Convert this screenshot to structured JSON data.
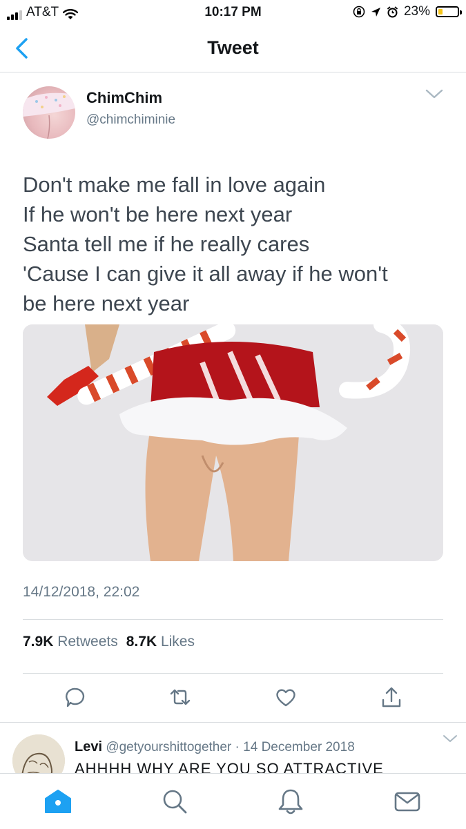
{
  "status_bar": {
    "carrier": "AT&T",
    "time": "10:17 PM",
    "battery": "23%",
    "battery_level": 0.23
  },
  "header": {
    "title": "Tweet",
    "back_icon": "chevron-left-icon"
  },
  "tweet": {
    "author_name": "ChimChim",
    "author_handle": "@chimchiminie",
    "lines": [
      "Don't make me fall in love again",
      "If he won't be here next year",
      "Santa tell me if he really cares",
      "'Cause I can give it all away if he won't",
      "be here next year"
    ],
    "timestamp": "14/12/2018, 22:02",
    "retweets_count": "7.9K",
    "retweets_label": "Retweets",
    "likes_count": "8.7K",
    "likes_label": "Likes",
    "actions": [
      "reply-icon",
      "retweet-icon",
      "like-icon",
      "share-icon"
    ]
  },
  "reply": {
    "name": "Levi",
    "handle": "@getyourshittogether",
    "separator": "·",
    "date": "14 December 2018",
    "text": "AHHHH WHY ARE YOU SO ATTRACTIVE"
  },
  "tab_bar": {
    "tabs": [
      "home-icon",
      "search-icon",
      "notifications-icon",
      "messages-icon"
    ],
    "active": "home-icon"
  },
  "colors": {
    "accent": "#1da1f2",
    "secondary_text": "#657786",
    "primary_text": "#14171a",
    "divider": "#d9dde0",
    "battery_fill": "#f5c518"
  }
}
